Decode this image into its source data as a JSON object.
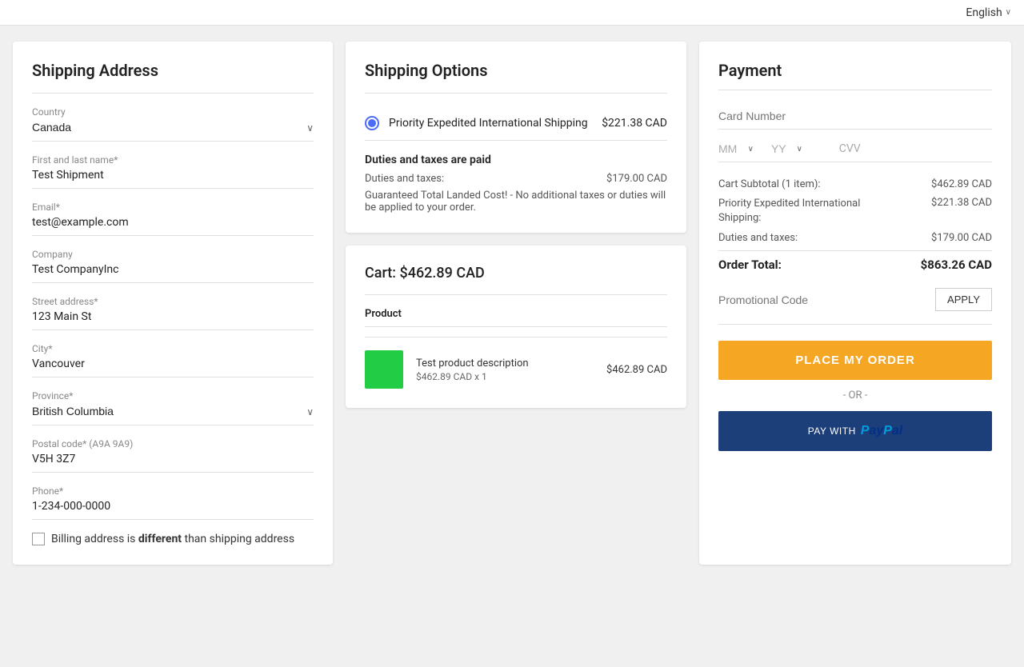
{
  "topbar": {
    "language_label": "English",
    "language_chevron": "∨"
  },
  "shipping_address": {
    "title": "Shipping Address",
    "country_label": "Country",
    "country_value": "Canada",
    "name_label": "First and last name*",
    "name_value": "Test Shipment",
    "email_label": "Email*",
    "email_value": "test@example.com",
    "company_label": "Company",
    "company_value": "Test CompanyInc",
    "street_label": "Street address*",
    "street_value": "123 Main St",
    "city_label": "City*",
    "city_value": "Vancouver",
    "province_label": "Province*",
    "province_value": "British Columbia",
    "postal_label": "Postal code* (A9A 9A9)",
    "postal_value": "V5H 3Z7",
    "phone_label": "Phone*",
    "phone_value": "1-234-000-0000",
    "billing_checkbox_label": "Billing address is ",
    "billing_different": "different",
    "billing_suffix": " than shipping address"
  },
  "shipping_options": {
    "title": "Shipping Options",
    "option_name": "Priority Expedited International Shipping",
    "option_price": "$221.38 CAD",
    "duties_title": "Duties and taxes are paid",
    "duties_label": "Duties and taxes:",
    "duties_value": "$179.00 CAD",
    "duties_note": "Guaranteed Total Landed Cost! - No additional taxes or duties will be applied to your order."
  },
  "cart": {
    "title": "Cart:",
    "total": "$462.89 CAD",
    "column_label": "Product",
    "item_name": "Test product description",
    "item_price": "$462.89 CAD",
    "item_qty": "$462.89 CAD x 1"
  },
  "payment": {
    "title": "Payment",
    "card_number_placeholder": "Card Number",
    "mm_placeholder": "MM",
    "yy_placeholder": "YY",
    "cvv_placeholder": "CVV",
    "cart_subtotal_label": "Cart Subtotal (1 item):",
    "cart_subtotal_value": "$462.89 CAD",
    "shipping_label": "Priority Expedited International Shipping:",
    "shipping_value": "$221.38 CAD",
    "duties_label": "Duties and taxes:",
    "duties_value": "$179.00 CAD",
    "order_total_label": "Order Total:",
    "order_total_value": "$863.26 CAD",
    "promo_placeholder": "Promotional Code",
    "apply_label": "APPLY",
    "place_order_label": "PLACE MY ORDER",
    "or_label": "- OR -",
    "paypal_label": "PAY WITH",
    "paypal_logo": "PayPal"
  }
}
